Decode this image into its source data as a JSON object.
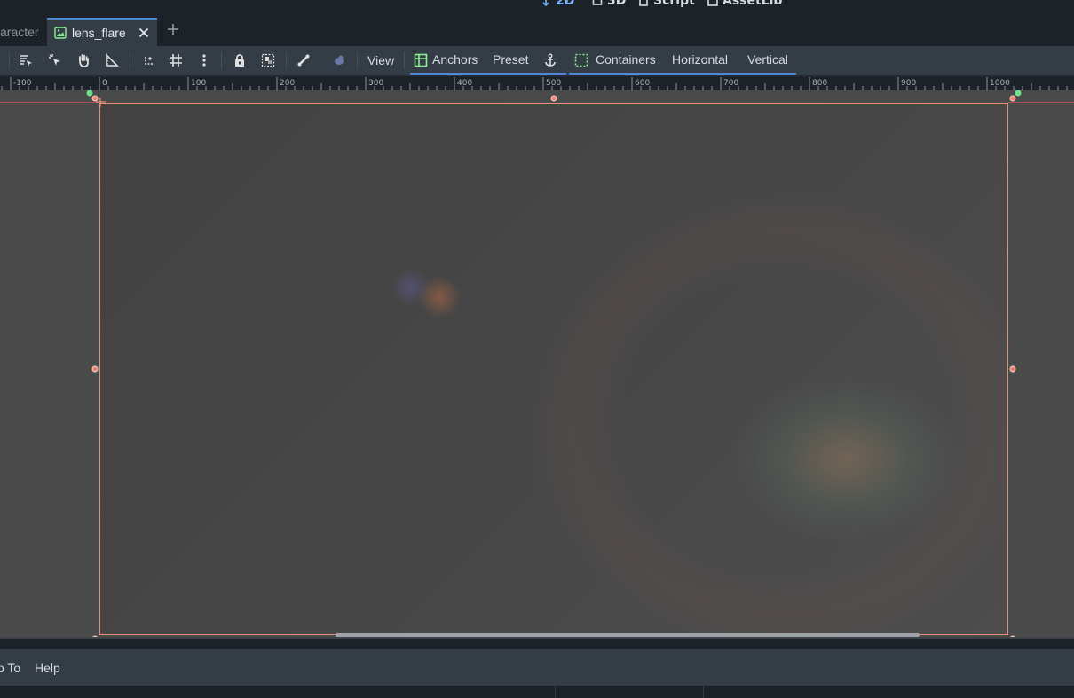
{
  "workspaces": [
    {
      "label": "2D",
      "icon": "2d-move-icon",
      "active": true
    },
    {
      "label": "3D",
      "icon": "3d-icon",
      "active": false
    },
    {
      "label": "Script",
      "icon": "script-icon",
      "active": false
    },
    {
      "label": "AssetLib",
      "icon": "assetlib-icon",
      "active": false
    }
  ],
  "tabs": [
    {
      "label": "aracter",
      "active": false
    },
    {
      "label": "lens_flare",
      "active": true,
      "icon": "image-texture-icon"
    }
  ],
  "toolbar": {
    "icons": [
      "select-mode-icon",
      "select-list-icon",
      "pan-hand-icon",
      "ruler-icon",
      "smart-snap-icon",
      "grid-snap-icon",
      "more-options-icon",
      "lock-icon",
      "group-icon",
      "bone-icon",
      "skeleton-icon"
    ],
    "view_label": "View",
    "anchors_label": "Anchors",
    "preset_label": "Preset",
    "containers_label": "Containers",
    "horizontal_label": "Horizontal",
    "vertical_label": "Vertical"
  },
  "ruler": {
    "labels": [
      "-100",
      "0",
      "100",
      "200",
      "300",
      "400",
      "500",
      "600",
      "700",
      "800",
      "900",
      "1000"
    ]
  },
  "menu": {
    "goto_label": "o To",
    "help_label": "Help"
  },
  "colors": {
    "accent": "#4d89d4",
    "selection": "#e88f77",
    "anchor": "#6be28b",
    "panel": "#343c46",
    "background": "#1d2229",
    "canvas": "#4a4a4a"
  }
}
